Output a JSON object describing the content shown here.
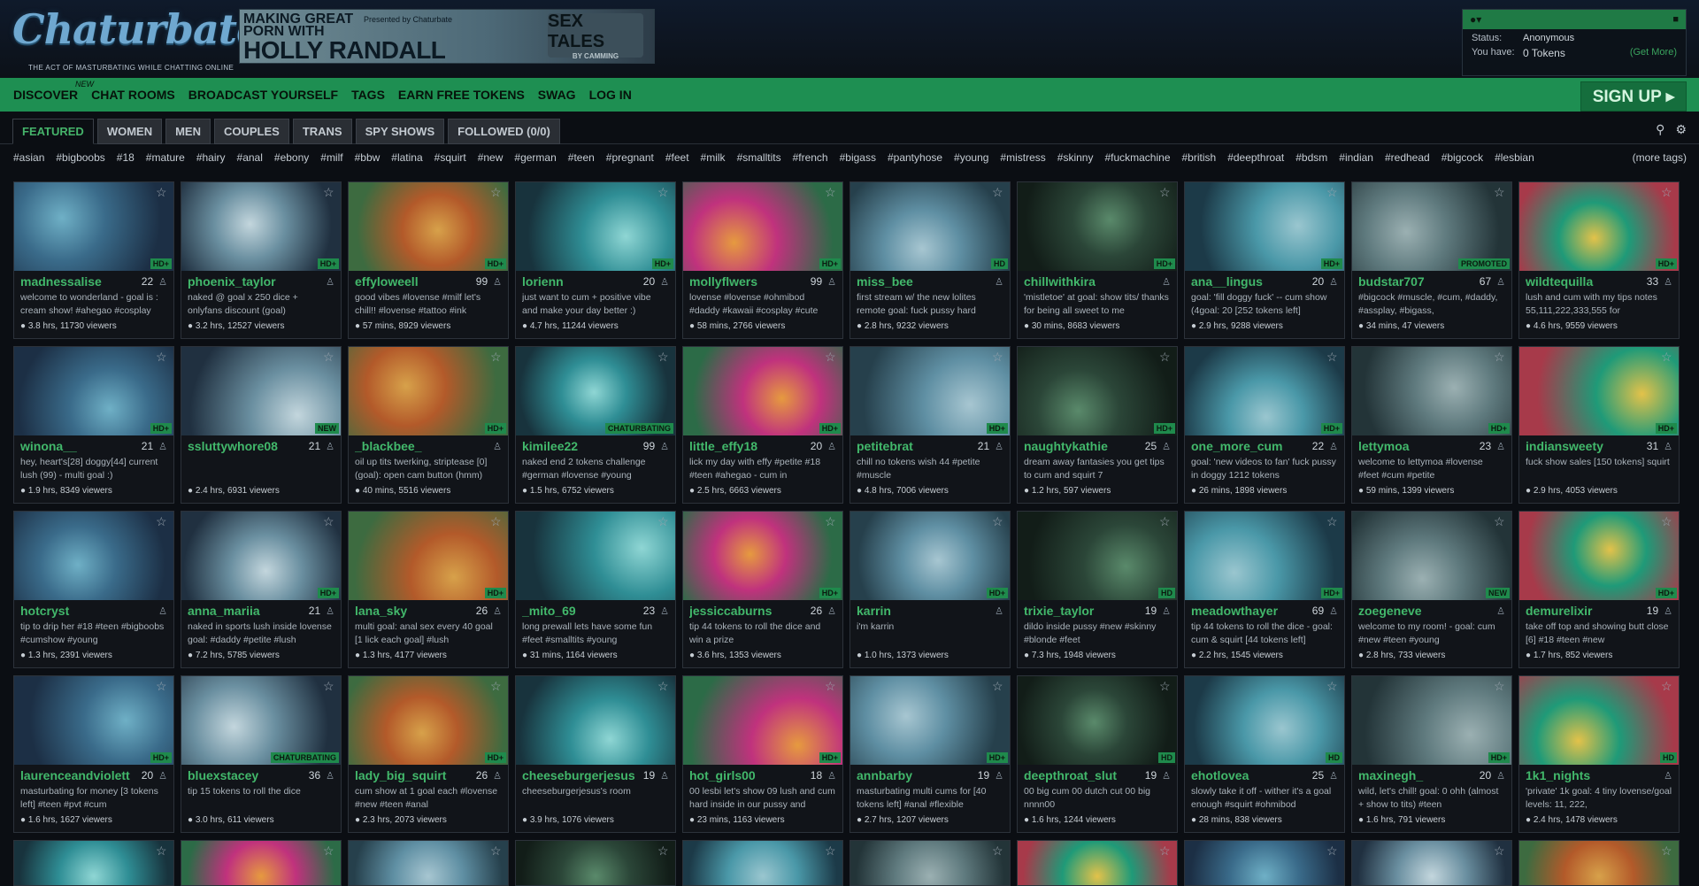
{
  "header": {
    "logo_text": "Chaturbate",
    "tagline": "THE ACT OF MASTURBATING WHILE CHATTING ONLINE",
    "banner": {
      "line1": "MAKING GREAT",
      "line2": "PORN WITH",
      "line3": "HOLLY RANDALL",
      "presented": "Presented by Chaturbate",
      "side_title": "SEX TALES",
      "side_by": "BY CAMMING"
    },
    "user": {
      "status_label": "Status:",
      "status_value": "Anonymous",
      "have_label": "You have:",
      "tokens": "0 Tokens",
      "get_more": "(Get More)"
    }
  },
  "nav": {
    "items": [
      "DISCOVER",
      "CHAT ROOMS",
      "BROADCAST YOURSELF",
      "TAGS",
      "EARN FREE TOKENS",
      "SWAG",
      "LOG IN"
    ],
    "new_label": "new",
    "signup": "SIGN UP ▸"
  },
  "tabs": [
    "FEATURED",
    "WOMEN",
    "MEN",
    "COUPLES",
    "TRANS",
    "SPY SHOWS",
    "FOLLOWED (0/0)"
  ],
  "tags": [
    "#asian",
    "#bigboobs",
    "#18",
    "#mature",
    "#hairy",
    "#anal",
    "#ebony",
    "#milf",
    "#bbw",
    "#latina",
    "#squirt",
    "#new",
    "#german",
    "#teen",
    "#pregnant",
    "#feet",
    "#milk",
    "#smalltits",
    "#french",
    "#bigass",
    "#pantyhose",
    "#young",
    "#mistress",
    "#skinny",
    "#fuckmachine",
    "#british",
    "#deepthroat",
    "#bdsm",
    "#indian",
    "#redhead",
    "#bigcock",
    "#lesbian"
  ],
  "more_tags": "(more tags)",
  "rooms": [
    {
      "name": "madnessalise",
      "age": "22",
      "subj": "welcome to wonderland - goal is : cream show! #ahegao #cosplay",
      "stats": "3.8 hrs, 11730 viewers",
      "badge": "HD+"
    },
    {
      "name": "phoenix_taylor",
      "age": "",
      "subj": "naked @ goal x 250 dice + onlyfans discount (goal)",
      "stats": "3.2 hrs, 12527 viewers",
      "badge": "HD+"
    },
    {
      "name": "effyloweell",
      "age": "99",
      "subj": "good vibes #lovense #milf let's chill!! #lovense #tattoo #ink",
      "stats": "57 mins, 8929 viewers",
      "badge": "HD+"
    },
    {
      "name": "lorienn",
      "age": "20",
      "subj": "just want to cum + positive vibe and make your day better :)",
      "stats": "4.7 hrs, 11244 viewers",
      "badge": "HD+"
    },
    {
      "name": "mollyflwers",
      "age": "99",
      "subj": "lovense #lovense #ohmibod #daddy #kawaii #cosplay #cute",
      "stats": "58 mins, 2766 viewers",
      "badge": "HD+"
    },
    {
      "name": "miss_bee",
      "age": "",
      "subj": "first stream w/ the new lolites remote goal: fuck pussy hard",
      "stats": "2.8 hrs, 9232 viewers",
      "badge": "HD"
    },
    {
      "name": "chillwithkira",
      "age": "",
      "subj": "'mistletoe' at goal: show tits/ thanks for being all sweet to me",
      "stats": "30 mins, 8683 viewers",
      "badge": "HD+"
    },
    {
      "name": "ana__lingus",
      "age": "20",
      "subj": "goal: 'fill doggy fuck' -- cum show (4goal: 20 [252 tokens left]",
      "stats": "2.9 hrs, 9288 viewers",
      "badge": "HD+"
    },
    {
      "name": "budstar707",
      "age": "67",
      "subj": "#bigcock #muscle, #cum, #daddy, #assplay, #bigass,",
      "stats": "34 mins, 47 viewers",
      "badge": "PROMOTED"
    },
    {
      "name": "wildtequilla",
      "age": "33",
      "subj": "lush and cum with my tips notes 55,111,222,333,555 for",
      "stats": "4.6 hrs, 9559 viewers",
      "badge": "HD+"
    },
    {
      "name": "winona__",
      "age": "21",
      "subj": "hey, heart's[28] doggy[44] current lush (99) - multi goal :)",
      "stats": "1.9 hrs, 8349 viewers",
      "badge": "HD+"
    },
    {
      "name": "ssluttywhore08",
      "age": "21",
      "subj": "",
      "stats": "2.4 hrs, 6931 viewers",
      "badge": "NEW"
    },
    {
      "name": "_blackbee_",
      "age": "",
      "subj": "oil up tits twerking, striptease [0] (goal): open cam button (hmm)",
      "stats": "40 mins, 5516 viewers",
      "badge": "HD+"
    },
    {
      "name": "kimilee22",
      "age": "99",
      "subj": "naked end 2 tokens challenge #german #lovense #young",
      "stats": "1.5 hrs, 6752 viewers",
      "badge": "CHATURBATING"
    },
    {
      "name": "little_effy18",
      "age": "20",
      "subj": "lick my day with effy #petite #18 #teen #ahegao - cum in",
      "stats": "2.5 hrs, 6663 viewers",
      "badge": "HD+"
    },
    {
      "name": "petitebrat",
      "age": "21",
      "subj": "chill no tokens wish 44 #petite #muscle",
      "stats": "4.8 hrs, 7006 viewers",
      "badge": "HD+"
    },
    {
      "name": "naughtykathie",
      "age": "25",
      "subj": "dream away fantasies you get tips to cum and squirt 7",
      "stats": "1.2 hrs, 597 viewers",
      "badge": "HD+"
    },
    {
      "name": "one_more_cum",
      "age": "22",
      "subj": "goal: 'new videos to fan' fuck pussy in doggy 1212 tokens",
      "stats": "26 mins, 1898 viewers",
      "badge": "HD+"
    },
    {
      "name": "lettymoa",
      "age": "23",
      "subj": "welcome to lettymoa #lovense #feet #cum #petite",
      "stats": "59 mins, 1399 viewers",
      "badge": "HD+"
    },
    {
      "name": "indiansweety",
      "age": "31",
      "subj": "fuck show sales [150 tokens] squirt",
      "stats": "2.9 hrs, 4053 viewers",
      "badge": "HD+"
    },
    {
      "name": "hotcryst",
      "age": "",
      "subj": "tip to drip her #18 #teen #bigboobs #cumshow #young",
      "stats": "1.3 hrs, 2391 viewers",
      "badge": ""
    },
    {
      "name": "anna_mariia",
      "age": "21",
      "subj": "naked in sports lush inside lovense goal: #daddy #petite #lush",
      "stats": "7.2 hrs, 5785 viewers",
      "badge": "HD+"
    },
    {
      "name": "lana_sky",
      "age": "26",
      "subj": "multi goal: anal sex every 40 goal [1 lick each goal] #lush",
      "stats": "1.3 hrs, 4177 viewers",
      "badge": "HD+"
    },
    {
      "name": "_mito_69",
      "age": "23",
      "subj": "long prewall lets have some fun #feet #smalltits #young",
      "stats": "31 mins, 1164 viewers",
      "badge": ""
    },
    {
      "name": "jessiccaburns",
      "age": "26",
      "subj": "tip 44 tokens to roll the dice and win a prize",
      "stats": "3.6 hrs, 1353 viewers",
      "badge": "HD+"
    },
    {
      "name": "karrin",
      "age": "",
      "subj": "i'm karrin",
      "stats": "1.0 hrs, 1373 viewers",
      "badge": "HD+"
    },
    {
      "name": "trixie_taylor",
      "age": "19",
      "subj": "dildo inside pussy #new #skinny #blonde #feet",
      "stats": "7.3 hrs, 1948 viewers",
      "badge": "HD"
    },
    {
      "name": "meadowthayer",
      "age": "69",
      "subj": "tip 44 tokens to roll the dice - goal: cum & squirt [44 tokens left]",
      "stats": "2.2 hrs, 1545 viewers",
      "badge": "HD+"
    },
    {
      "name": "zoegeneve",
      "age": "",
      "subj": "welcome to my room! - goal: cum #new #teen #young",
      "stats": "2.8 hrs, 733 viewers",
      "badge": "NEW"
    },
    {
      "name": "demurelixir",
      "age": "19",
      "subj": "take off top and showing butt close [6] #18 #teen #new",
      "stats": "1.7 hrs, 852 viewers",
      "badge": "HD+"
    },
    {
      "name": "laurenceandviolett",
      "age": "20",
      "subj": "masturbating for money [3 tokens left] #teen #pvt #cum",
      "stats": "1.6 hrs, 1627 viewers",
      "badge": "HD+"
    },
    {
      "name": "bluexstacey",
      "age": "36",
      "subj": "tip 15 tokens to roll the dice",
      "stats": "3.0 hrs, 611 viewers",
      "badge": "CHATURBATING"
    },
    {
      "name": "lady_big_squirt",
      "age": "26",
      "subj": "cum show at 1 goal each #lovense #new #teen #anal",
      "stats": "2.3 hrs, 2073 viewers",
      "badge": "HD+"
    },
    {
      "name": "cheeseburgerjesus",
      "age": "19",
      "subj": "cheeseburgerjesus's room",
      "stats": "3.9 hrs, 1076 viewers",
      "badge": ""
    },
    {
      "name": "hot_girls00",
      "age": "18",
      "subj": "00 lesbi let's show 09 lush and cum hard inside in our pussy and",
      "stats": "23 mins, 1163 viewers",
      "badge": "HD+"
    },
    {
      "name": "annbarby",
      "age": "19",
      "subj": "masturbating multi cums for [40 tokens left] #anal #flexible",
      "stats": "2.7 hrs, 1207 viewers",
      "badge": "HD+"
    },
    {
      "name": "deepthroat_slut",
      "age": "19",
      "subj": "00 big cum 00 dutch cut 00 big nnnn00",
      "stats": "1.6 hrs, 1244 viewers",
      "badge": "HD"
    },
    {
      "name": "ehotlovea",
      "age": "25",
      "subj": "slowly take it off - wither it's a goal enough #squirt #ohmibod",
      "stats": "28 mins, 838 viewers",
      "badge": "HD"
    },
    {
      "name": "maxinegh_",
      "age": "20",
      "subj": "wild, let's chill! goal: 0 ohh (almost + show to tits) #teen",
      "stats": "1.6 hrs, 791 viewers",
      "badge": "HD+"
    },
    {
      "name": "1k1_nights",
      "age": "",
      "subj": "'private' 1k goal: 4 tiny lovense/goal levels: 11, 222,",
      "stats": "2.4 hrs, 1478 viewers",
      "badge": "HD"
    }
  ]
}
